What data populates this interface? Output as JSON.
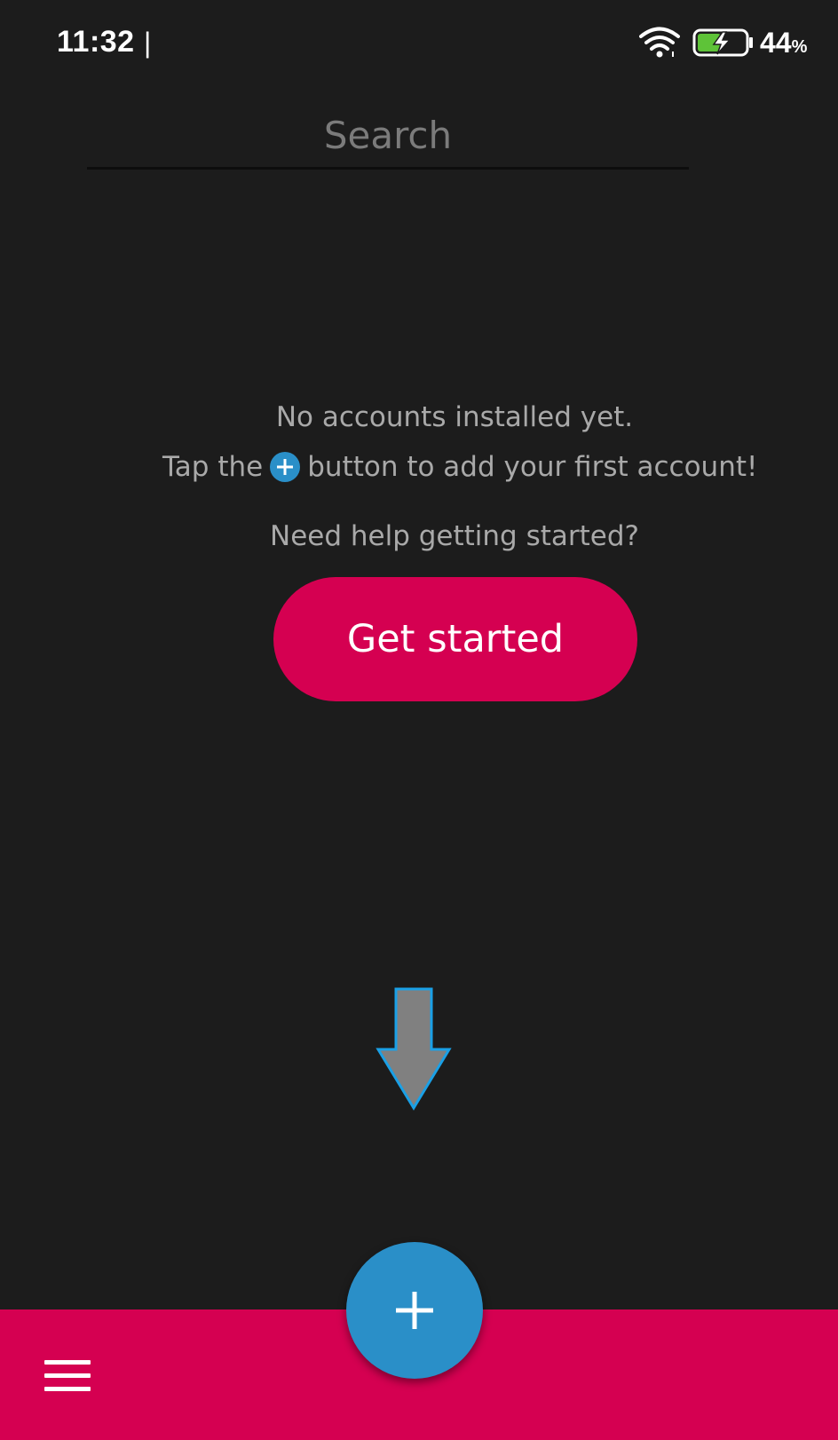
{
  "status_bar": {
    "time": "11:32",
    "cursor": "|",
    "battery_value": "44",
    "battery_unit": "%",
    "icons": [
      "wifi-icon",
      "battery-charging-icon"
    ]
  },
  "search": {
    "placeholder": "Search",
    "value": ""
  },
  "empty_state": {
    "line1": "No accounts installed yet.",
    "line2_before": "Tap the",
    "line2_icon": "plus-circle-icon",
    "line2_after": "button to add your first account!",
    "help_text": "Need help getting started?",
    "get_started_label": "Get started"
  },
  "hint": {
    "icon": "arrow-down-icon"
  },
  "bottom_bar": {
    "menu_icon": "hamburger-menu-icon",
    "fab_icon": "plus-icon"
  },
  "colors": {
    "background": "#1c1c1c",
    "accent": "#d50051",
    "fab": "#2a8fc8",
    "text_muted": "#a9a9a9"
  }
}
